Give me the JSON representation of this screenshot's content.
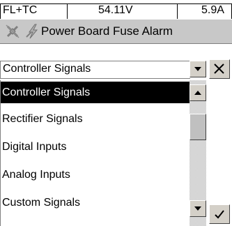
{
  "status": {
    "mode": "FL+TC",
    "voltage": "54.11V",
    "current": "5.9A"
  },
  "alarm": {
    "message": "Power Board Fuse Alarm"
  },
  "signal_select": {
    "selected_value": "Controller Signals"
  },
  "signal_list": {
    "items": [
      {
        "label": "Controller Signals"
      },
      {
        "label": "Rectifier Signals"
      },
      {
        "label": "Digital Inputs"
      },
      {
        "label": "Analog Inputs"
      },
      {
        "label": "Custom Signals"
      }
    ]
  },
  "icons": {
    "alarm_bell": "muted-alarm-icon",
    "power": "power-lightning-icon",
    "dropdown": "chevron-down-icon",
    "close": "close-icon",
    "scroll_up": "arrow-up-icon",
    "scroll_down": "arrow-down-icon",
    "confirm": "checkmark-icon"
  },
  "colors": {
    "selection_background": "#000000",
    "selection_text": "#ffffff",
    "alarm_background": "#c8c8c8",
    "button_face": "#d4d0c8"
  }
}
